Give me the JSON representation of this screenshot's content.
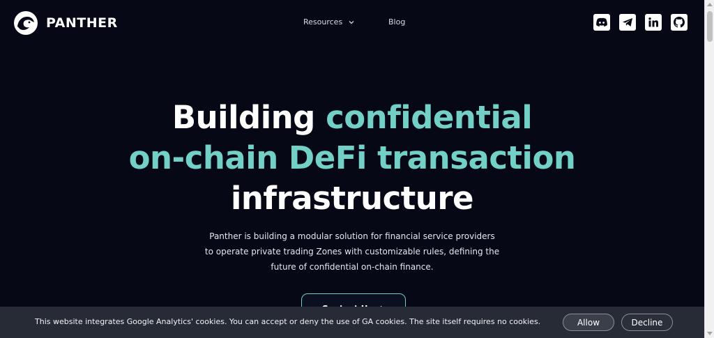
{
  "header": {
    "brand": "PANTHER",
    "nav": [
      {
        "label": "Resources",
        "icon": "chevron-down-icon"
      },
      {
        "label": "Blog"
      }
    ],
    "socials": [
      "discord-icon",
      "telegram-icon",
      "linkedin-icon",
      "github-icon"
    ]
  },
  "hero": {
    "title_part1": "Building ",
    "title_part2": "confidential",
    "title_part3": "on-chain DeFi transaction",
    "title_part4": "infrastructure",
    "desc_line1": "Panther is building a modular solution for financial service providers",
    "desc_line2": "to operate private trading Zones with customizable rules, defining the",
    "desc_line3": "future of confidential on-chain finance.",
    "cta_label": "Contact Us",
    "cta_icon": "arrow-right-icon"
  },
  "cookie": {
    "text": "This website integrates Google Analytics' cookies. You can accept or deny the use of GA cookies. The site itself requires no cookies.",
    "allow_label": "Allow",
    "decline_label": "Decline"
  },
  "colors": {
    "background": "#070815",
    "accent": "#72d0c6",
    "cookie_bar": "#262b35"
  }
}
